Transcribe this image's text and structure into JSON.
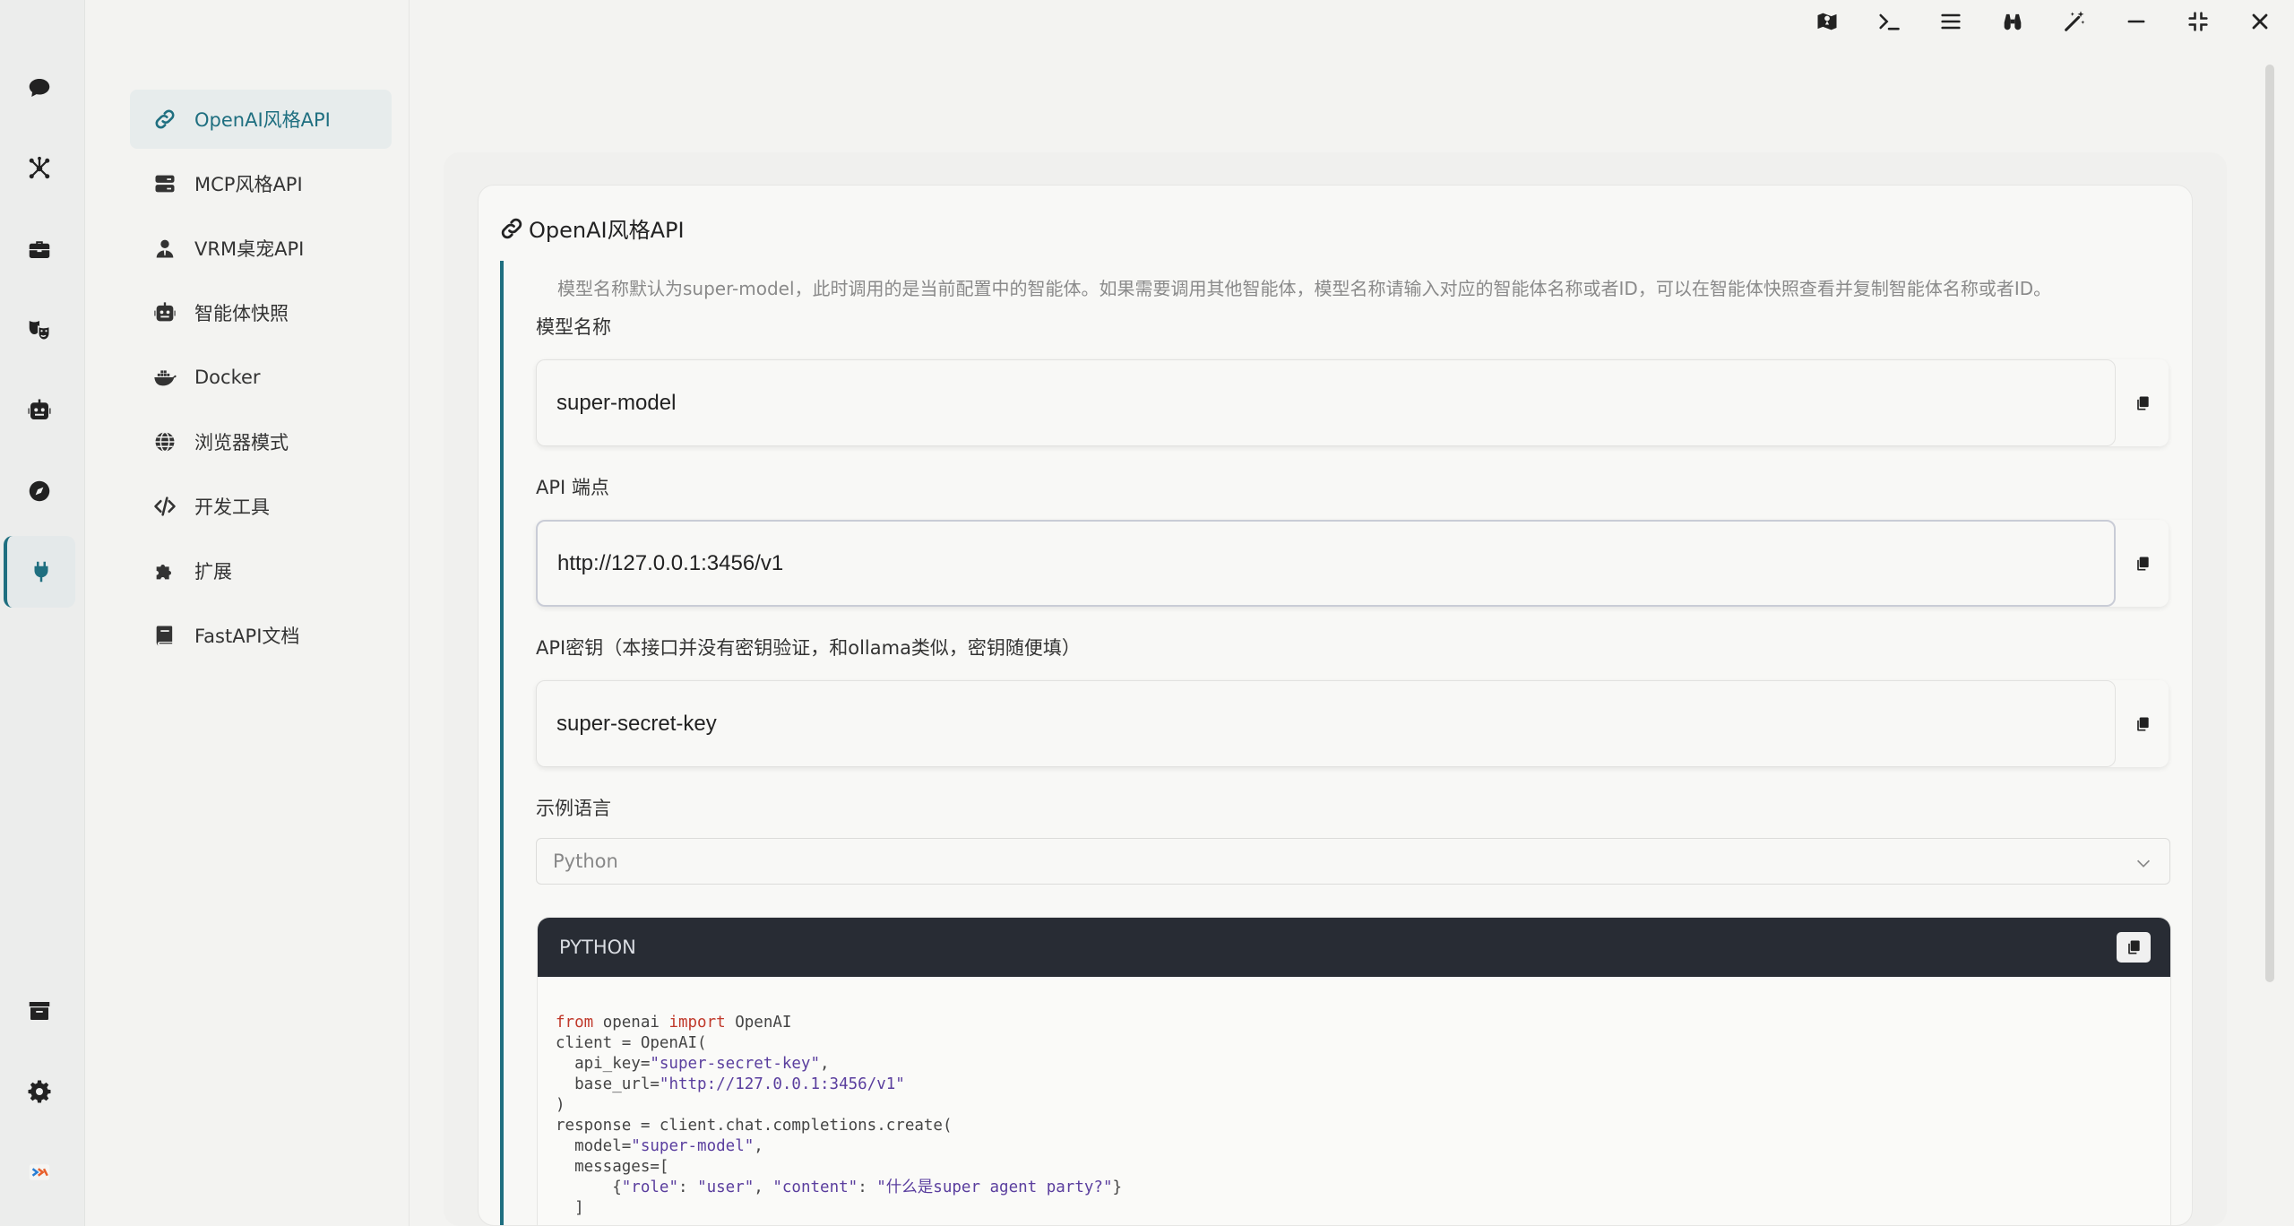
{
  "rail": {
    "items": [
      {
        "name": "chat",
        "icon": "chat-bubble-icon"
      },
      {
        "name": "agents",
        "icon": "network-icon"
      },
      {
        "name": "toolkit",
        "icon": "toolbox-icon"
      },
      {
        "name": "roles",
        "icon": "masks-icon"
      },
      {
        "name": "robot",
        "icon": "robot-icon"
      },
      {
        "name": "explore",
        "icon": "compass-icon"
      },
      {
        "name": "api",
        "icon": "plug-icon",
        "active": true
      }
    ],
    "bottom": [
      {
        "name": "archive",
        "icon": "archive-icon"
      },
      {
        "name": "settings",
        "icon": "gear-icon"
      },
      {
        "name": "logo",
        "icon": "logo-icon"
      }
    ]
  },
  "subnav": {
    "items": [
      {
        "label": "OpenAI风格API",
        "icon": "link-icon",
        "active": true
      },
      {
        "label": "MCP风格API",
        "icon": "server-icon"
      },
      {
        "label": "VRM桌宠API",
        "icon": "user-tie-icon"
      },
      {
        "label": "智能体快照",
        "icon": "robot-icon"
      },
      {
        "label": "Docker",
        "icon": "docker-icon"
      },
      {
        "label": "浏览器模式",
        "icon": "globe-icon"
      },
      {
        "label": "开发工具",
        "icon": "code-icon"
      },
      {
        "label": "扩展",
        "icon": "puzzle-icon"
      },
      {
        "label": "FastAPI文档",
        "icon": "book-icon"
      }
    ]
  },
  "window_controls": [
    "map-icon",
    "terminal-icon",
    "menu-icon",
    "binoculars-icon",
    "magic-wand-icon",
    "minimize-icon",
    "restore-icon",
    "close-icon"
  ],
  "panel": {
    "title": "OpenAI风格API",
    "description": "模型名称默认为super-model，此时调用的是当前配置中的智能体。如果需要调用其他智能体，模型名称请输入对应的智能体名称或者ID，可以在智能体快照查看并复制智能体名称或者ID。",
    "model_label": "模型名称",
    "model_value": "super-model",
    "endpoint_label": "API 端点",
    "endpoint_value": "http://127.0.0.1:3456/v1",
    "key_label": "API密钥（本接口并没有密钥验证，和ollama类似，密钥随便填）",
    "key_value": "super-secret-key",
    "lang_label": "示例语言",
    "lang_selected": "Python",
    "code_lang": "PYTHON",
    "code_lines": [
      "from openai import OpenAI",
      "client = OpenAI(",
      "  api_key=\"super-secret-key\",",
      "  base_url=\"http://127.0.0.1:3456/v1\"",
      ")",
      "response = client.chat.completions.create(",
      "  model=\"super-model\",",
      "  messages=[",
      "      {\"role\": \"user\", \"content\": \"什么是super agent party?\"}",
      "  ]"
    ]
  },
  "colors": {
    "accent": "#1f6f80",
    "code_header": "#282c34",
    "keyword": "#c0392b",
    "string": "#5a3e9e"
  }
}
